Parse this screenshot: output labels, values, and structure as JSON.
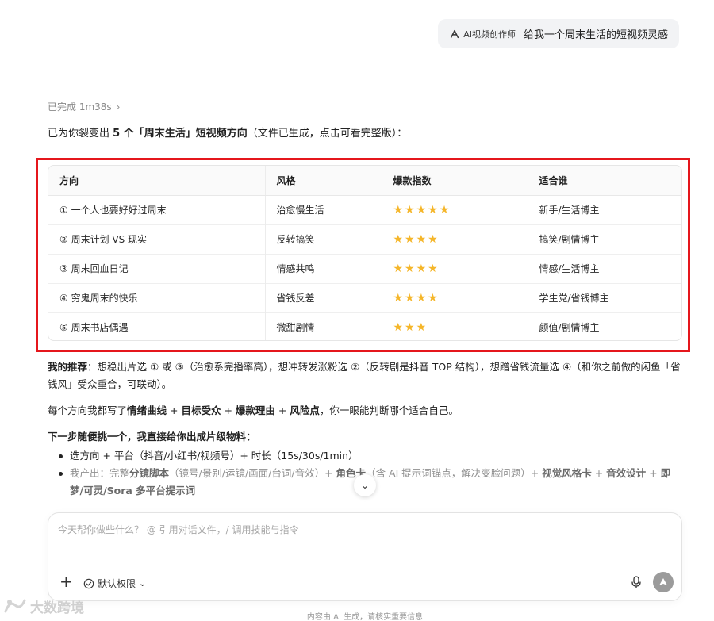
{
  "user_message": {
    "agent_label": "AI视频创作师",
    "text": "给我一个周末生活的短视频灵感"
  },
  "status": {
    "text": "已完成 1m38s"
  },
  "intro": {
    "prefix": "已为你裂变出 ",
    "bold": "5 个「周末生活」短视频方向",
    "suffix": "（文件已生成，点击可看完整版）："
  },
  "table": {
    "headers": [
      "方向",
      "风格",
      "爆款指数",
      "适合谁"
    ],
    "rows": [
      {
        "direction": "① 一个人也要好好过周末",
        "style": "治愈慢生活",
        "rating": 5,
        "audience": "新手/生活博主"
      },
      {
        "direction": "② 周末计划 VS 现实",
        "style": "反转搞笑",
        "rating": 4,
        "audience": "搞笑/剧情博主"
      },
      {
        "direction": "③ 周末回血日记",
        "style": "情感共鸣",
        "rating": 4,
        "audience": "情感/生活博主"
      },
      {
        "direction": "④ 穷鬼周末的快乐",
        "style": "省钱反差",
        "rating": 4,
        "audience": "学生党/省钱博主"
      },
      {
        "direction": "⑤ 周末书店偶遇",
        "style": "微甜剧情",
        "rating": 3,
        "audience": "颜值/剧情博主"
      }
    ],
    "star_color": "#f5b62a"
  },
  "recommendation": {
    "label": "我的推荐",
    "text": "：想稳出片选 ① 或 ③（治愈系完播率高），想冲转发涨粉选 ②（反转剧是抖音 TOP 结构），想蹭省钱流量选 ④（和你之前做的闲鱼「省钱风」受众重合，可联动）。"
  },
  "each_direction": {
    "t1": "每个方向我都写了",
    "b1": "情绪曲线",
    "t2": " + ",
    "b2": "目标受众",
    "t3": " + ",
    "b3": "爆款理由",
    "t4": " + ",
    "b4": "风险点",
    "t5": "，你一眼能判断哪个适合自己。"
  },
  "next_step": {
    "heading": "下一步随便挑一个，我直接给你出成片级物料：",
    "bullet1": "选方向 + 平台（抖音/小红书/视频号）+ 时长（15s/30s/1min）",
    "bullet2_prefix": "我产出：完整",
    "bullet2_b1": "分镜脚本",
    "bullet2_t1": "（镜号/景别/运镜/画面/台词/音效）+ ",
    "bullet2_b2": "角色卡",
    "bullet2_t2": "（含 AI 提示词锚点，解决变脸问题）+ ",
    "bullet2_b3": "视觉风格卡",
    "bullet2_t3": " + ",
    "bullet2_b4": "音效设计",
    "bullet2_t4": " + ",
    "bullet2_b5": "即梦/可灵/Sora 多平台提示词"
  },
  "composer": {
    "placeholder": "今天帮你做些什么？ @ 引用对话文件，/ 调用技能与指令",
    "permission_label": "默认权限"
  },
  "footer": {
    "text": "内容由 AI 生成，请核实重要信息"
  },
  "watermark": {
    "text": "大数跨境"
  },
  "highlight_color": "#e5161c"
}
